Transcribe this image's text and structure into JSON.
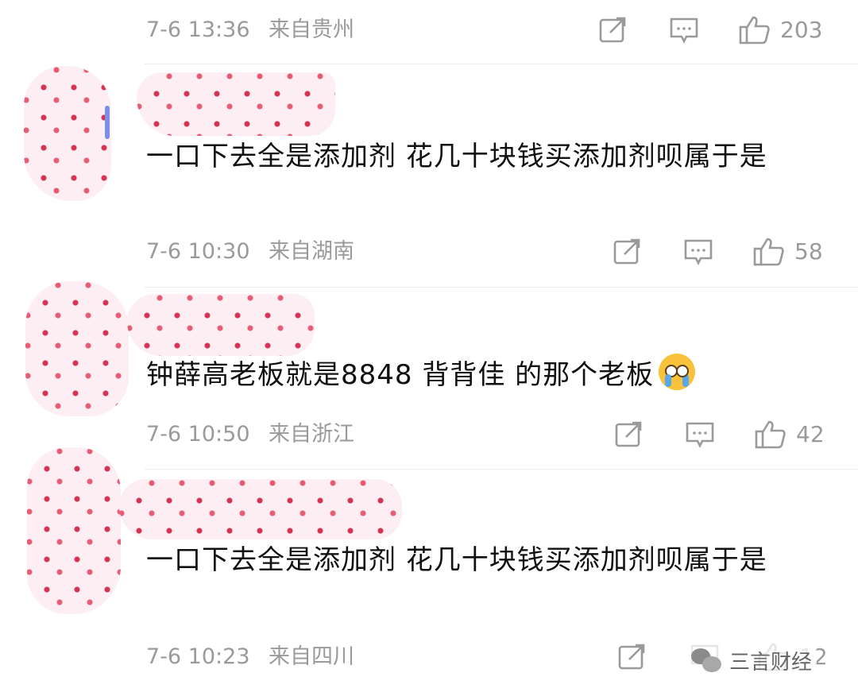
{
  "top": {
    "time": "7-6 13:36",
    "location": "来自贵州",
    "likes": "203"
  },
  "comments": [
    {
      "text": "一口下去全是添加剂 花几十块钱买添加剂呗属于是",
      "time": "7-6 10:30",
      "location": "来自湖南",
      "likes": "58"
    },
    {
      "text": "钟薛高老板就是8848 背背佳 的那个老板",
      "time": "7-6 10:50",
      "location": "来自浙江",
      "likes": "42"
    },
    {
      "text": "一口下去全是添加剂 花几十块钱买添加剂呗属于是",
      "time": "7-6 10:23",
      "location": "来自四川",
      "likes": "12"
    }
  ],
  "icons": {
    "share": "share-icon",
    "comment": "comment-icon",
    "like": "thumbs-up-icon",
    "wechat": "wechat-icon",
    "emoji": "crying-face-emoji"
  },
  "watermark": {
    "text": "三言财经"
  },
  "colors": {
    "mask_bg": "#fdeef3",
    "cherry": "#d63354",
    "meta": "#9a9a9a",
    "divider": "#ececec"
  }
}
